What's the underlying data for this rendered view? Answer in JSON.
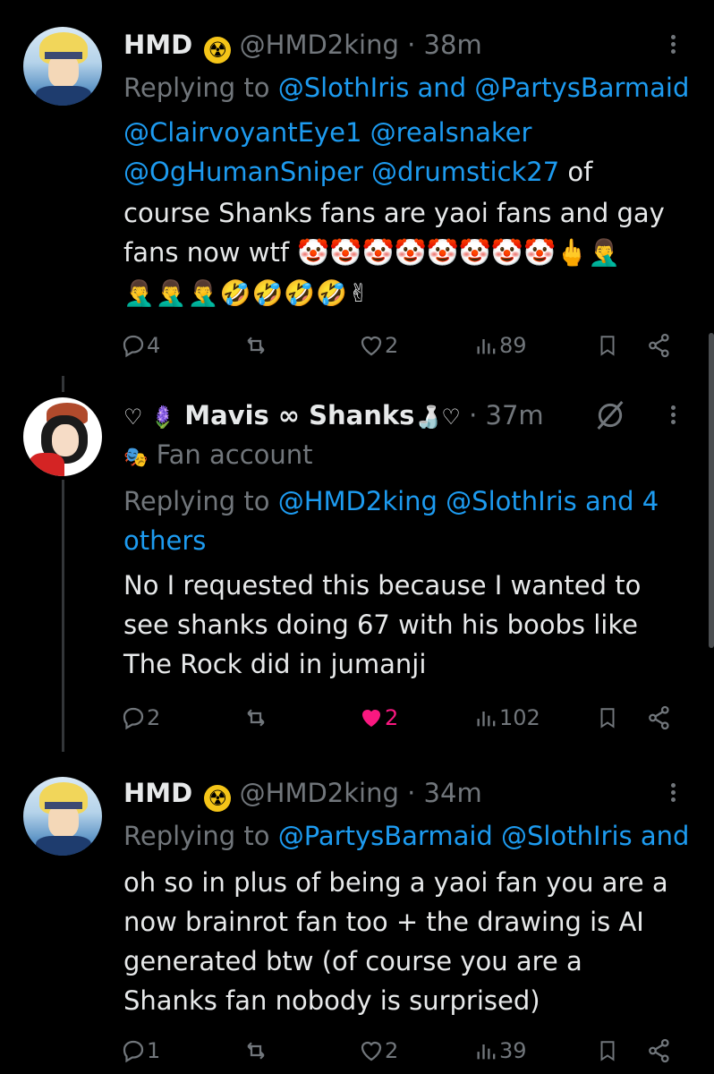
{
  "tweets": [
    {
      "name": "HMD",
      "badge": "☢",
      "handle": "@HMD2king",
      "dot": "·",
      "time": "38m",
      "replying_prefix": "Replying to ",
      "replying_links": "@SlothIris and @PartysBarmaid",
      "lines": [
        {
          "link": "@ClairvoyantEye1 @realsnaker",
          "text": ""
        },
        {
          "link": "@OgHumanSniper @drumstick27",
          "text": " of"
        },
        {
          "link": "",
          "text": "course Shanks fans are yaoi fans and gay"
        },
        {
          "link": "",
          "text": "fans now wtf 🤡🤡🤡🤡🤡🤡🤡🤡🖕🤦‍♂️"
        },
        {
          "link": "",
          "text": "🤦‍♂️🤦‍♂️🤦‍♂️🤣🤣🤣🤣✌"
        }
      ],
      "replies": "4",
      "reposts": "",
      "likes": "2",
      "views": "89"
    },
    {
      "name_prefix": "♡ 🪻",
      "name": "Mavis ∞ Shanks",
      "name_suffix": "🍶♡",
      "dot": "·",
      "time": "37m",
      "label_icon": "🎭",
      "label": "Fan account",
      "replying_prefix": "Replying to ",
      "replying_links": "@HMD2king @SlothIris and 4",
      "replying_line2": "others",
      "lines": [
        {
          "link": "",
          "text": "No I requested this because I wanted to"
        },
        {
          "link": "",
          "text": "see shanks doing 67 with his boobs like"
        },
        {
          "link": "",
          "text": "The Rock did in jumanji"
        }
      ],
      "replies": "2",
      "reposts": "",
      "likes": "2",
      "views": "102"
    },
    {
      "name": "HMD",
      "badge": "☢",
      "handle": "@HMD2king",
      "dot": "·",
      "time": "34m",
      "replying_prefix": "Replying to ",
      "replying_links": "@PartysBarmaid @SlothIris and",
      "lines": [
        {
          "link": "",
          "text": "oh so in plus of being a yaoi fan you are a"
        },
        {
          "link": "",
          "text": "now brainrot fan too + the drawing is AI"
        },
        {
          "link": "",
          "text": "generated btw (of course you are a"
        },
        {
          "link": "",
          "text": "Shanks fan nobody is surprised)"
        }
      ],
      "replies": "1",
      "reposts": "",
      "likes": "2",
      "views": "39"
    }
  ],
  "colors": {
    "link": "#1d9bf0",
    "muted": "#71767b",
    "like_active": "#f91880",
    "badge": "#f5c518"
  },
  "icons": {
    "reply": "reply-icon",
    "repost": "repost-icon",
    "like": "heart-icon",
    "views": "views-icon",
    "bookmark": "bookmark-icon",
    "share": "share-icon",
    "more": "more-icon",
    "grok": "grok-icon"
  }
}
